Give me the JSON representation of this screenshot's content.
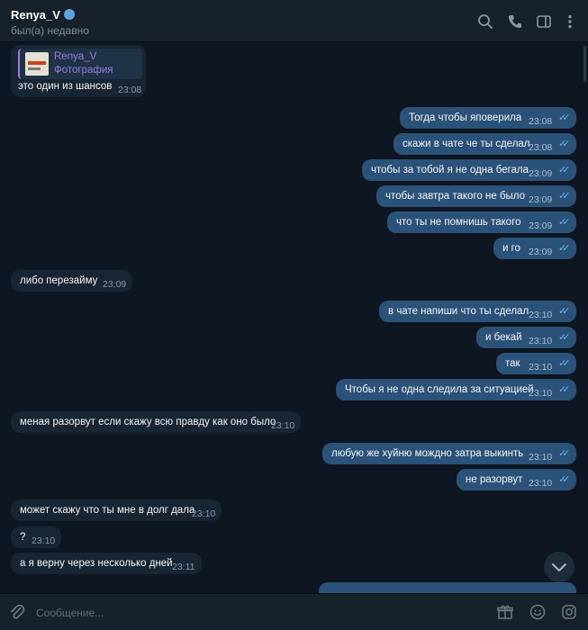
{
  "header": {
    "contact_name": "Renya_V",
    "status": "был(а) недавно",
    "icons": [
      "search-icon",
      "phone-icon",
      "sidebar-icon",
      "more-icon"
    ]
  },
  "reply_preview": {
    "sender": "Renya_V",
    "type": "Фотография",
    "text": "это один из шансов",
    "time": "23:08"
  },
  "messages": [
    {
      "side": "out",
      "text": "Тогда чтобы  яповерила",
      "time": "23:08"
    },
    {
      "side": "out",
      "text": "скажи в чате че ты сделал",
      "time": "23:08"
    },
    {
      "side": "out",
      "text": "чтобы за тобой я не одна бегала",
      "time": "23:09"
    },
    {
      "side": "out",
      "text": "чтобы завтра такого не было",
      "time": "23:09"
    },
    {
      "side": "out",
      "text": "что ты не помнишь такого",
      "time": "23:09"
    },
    {
      "side": "out",
      "text": "и го",
      "time": "23:09"
    },
    {
      "side": "in",
      "text": "либо перезайму",
      "time": "23:09"
    },
    {
      "side": "out",
      "text": "в чате напиши что ты сделал",
      "time": "23:10"
    },
    {
      "side": "out",
      "text": "и бекай",
      "time": "23:10"
    },
    {
      "side": "out",
      "text": "так",
      "time": "23:10"
    },
    {
      "side": "out",
      "text": "Чтобы я не одна следила за ситуацией",
      "time": "23:10"
    },
    {
      "side": "in",
      "text": "меная разорвут если скажу всю правду как оно было",
      "time": "23:10"
    },
    {
      "side": "out",
      "text": "любую же хуйню мождно затра выкинть",
      "time": "23:10"
    },
    {
      "side": "out",
      "text": "не разорвут",
      "time": "23:10"
    },
    {
      "side": "in",
      "text": "может скажу что ты мне в долг дала",
      "time": "23:10"
    },
    {
      "side": "in",
      "text": "?",
      "time": "23:10"
    },
    {
      "side": "in",
      "text": "а я верну через несколько дней",
      "time": "23:11"
    }
  ],
  "composer": {
    "placeholder": "Сообщение...",
    "icons": [
      "attach-icon",
      "gift-icon",
      "emoji-icon",
      "instagram-icon"
    ]
  },
  "colors": {
    "background": "#0e1621",
    "panel": "#17212b",
    "incoming_bubble": "#182533",
    "outgoing_bubble": "#2b5278",
    "read_ticks": "#6ab3f3",
    "reply_accent": "#9b7ae0"
  }
}
